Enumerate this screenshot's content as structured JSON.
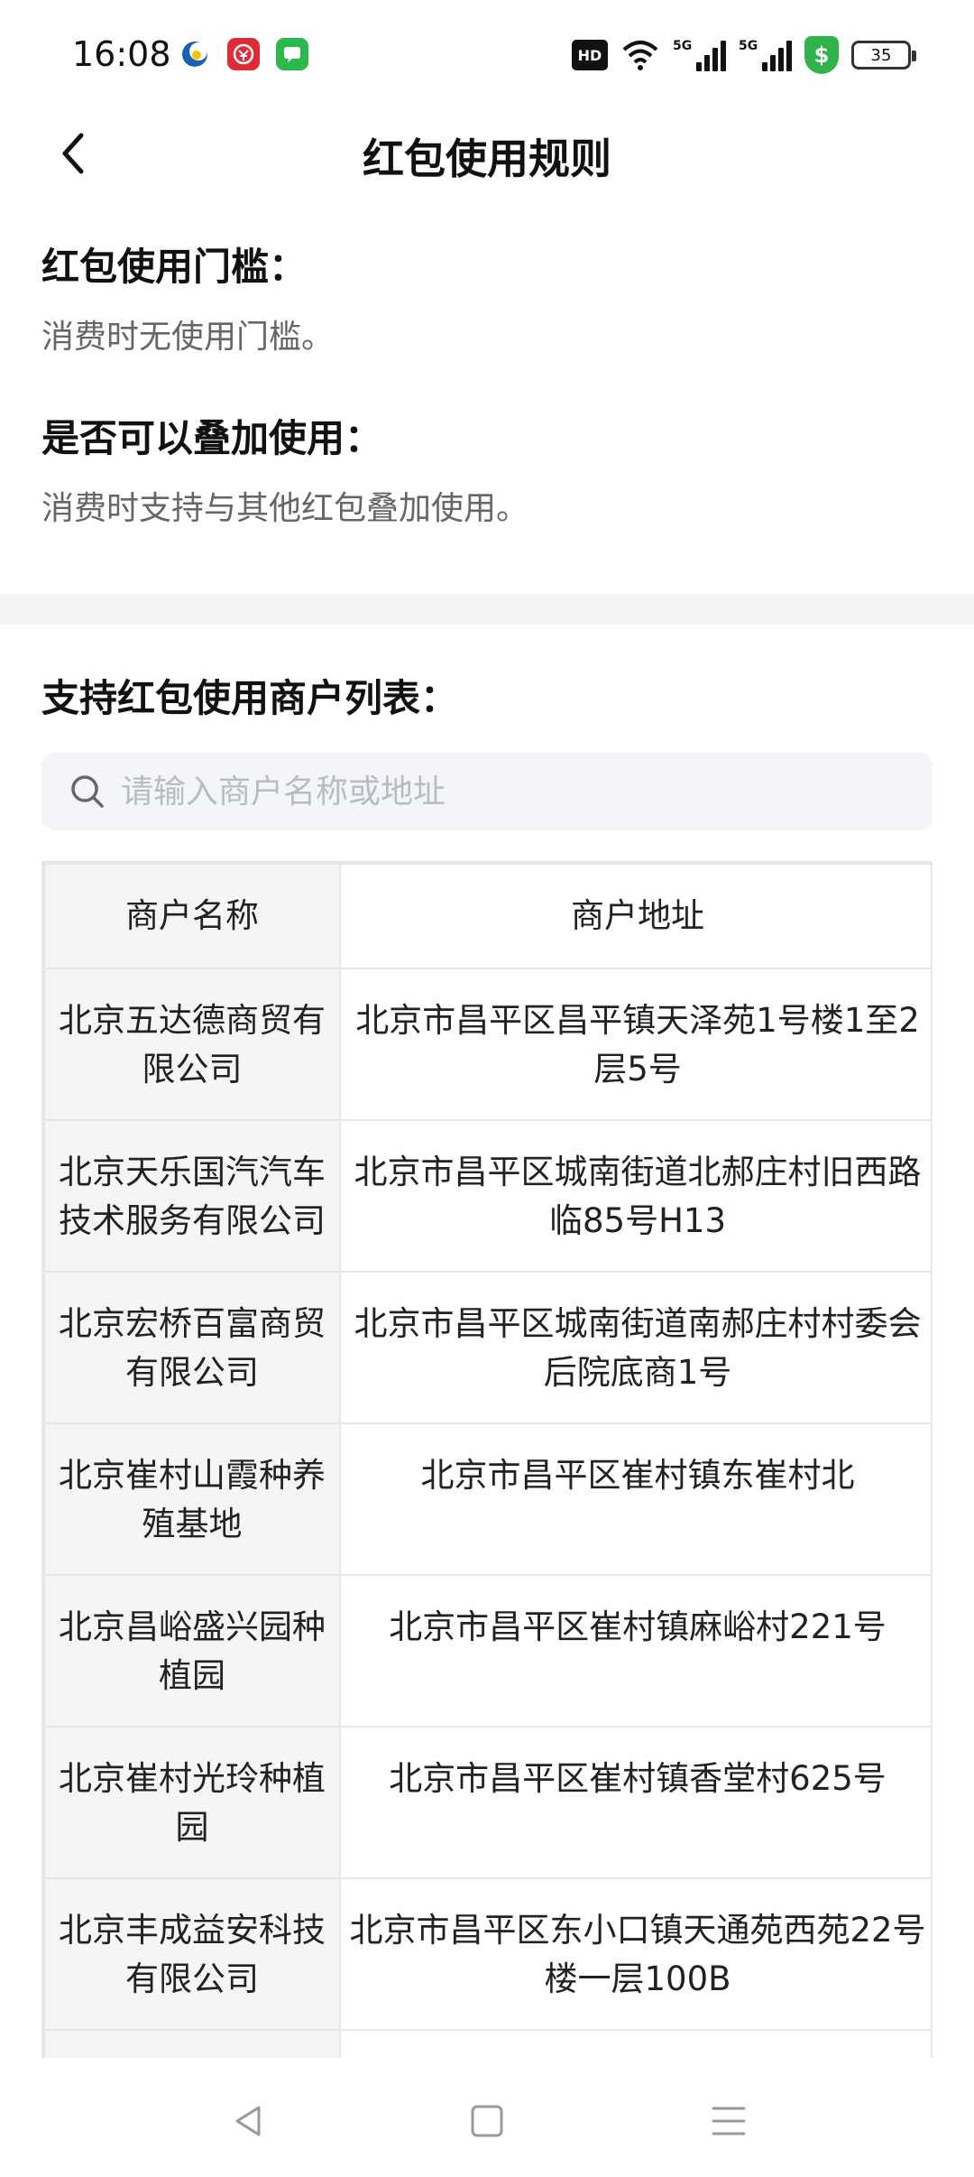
{
  "status_bar": {
    "time": "16:08",
    "hd_label": "HD",
    "network_label_1": "5G",
    "network_label_2": "5G",
    "shield_label": "$",
    "battery_level": "35",
    "icons": [
      "wechat-blue-moon-icon",
      "red-yuan-app-icon",
      "green-message-app-icon",
      "wifi-icon",
      "signal-icon",
      "shield-icon",
      "battery-icon"
    ]
  },
  "header": {
    "title": "红包使用规则",
    "back_icon": "chevron-left-icon"
  },
  "rules": [
    {
      "heading": "红包使用门槛：",
      "text": "消费时无使用门槛。"
    },
    {
      "heading": "是否可以叠加使用：",
      "text": "消费时支持与其他红包叠加使用。"
    }
  ],
  "merchants": {
    "heading": "支持红包使用商户列表：",
    "search_placeholder": "请输入商户名称或地址",
    "columns": {
      "name": "商户名称",
      "address": "商户地址"
    },
    "rows": [
      {
        "name": "北京五达德商贸有限公司",
        "address": "北京市昌平区昌平镇天泽苑1号楼1至2层5号"
      },
      {
        "name": "北京天乐国汽汽车技术服务有限公司",
        "address": "北京市昌平区城南街道北郝庄村旧西路临85号H13"
      },
      {
        "name": "北京宏桥百富商贸有限公司",
        "address": "北京市昌平区城南街道南郝庄村村委会后院底商1号"
      },
      {
        "name": "北京崔村山霞种养殖基地",
        "address": "北京市昌平区崔村镇东崔村北"
      },
      {
        "name": "北京昌峪盛兴园种植园",
        "address": "北京市昌平区崔村镇麻峪村221号"
      },
      {
        "name": "北京崔村光玲种植园",
        "address": "北京市昌平区崔村镇香堂村625号"
      },
      {
        "name": "北京丰成益安科技有限公司",
        "address": "北京市昌平区东小口镇天通苑西苑22号楼一层100B"
      }
    ]
  },
  "nav": {
    "icons": [
      "back-triangle-icon",
      "home-square-icon",
      "menu-lines-icon"
    ]
  },
  "colors": {
    "background": "#ffffff",
    "band": "#f3f3f5",
    "search_bg": "#f4f5f9",
    "name_col_bg": "#f5f5f5",
    "border": "#e6e6e6",
    "muted_text": "#666666",
    "shield_green": "#2fb34a"
  }
}
